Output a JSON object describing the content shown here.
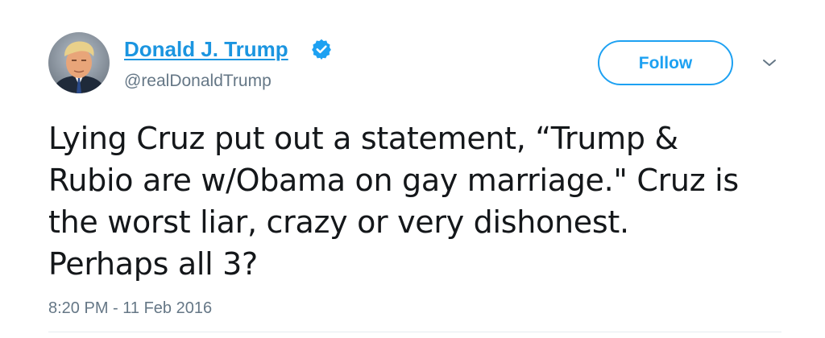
{
  "tweet": {
    "author": {
      "name": "Donald J. Trump",
      "handle": "@realDonaldTrump",
      "verified": true,
      "avatar_icon": "profile-photo"
    },
    "follow_label": "Follow",
    "text": "Lying Cruz put out a statement, “Trump &\nRubio are w/Obama on gay marriage.\" Cruz is\nthe worst liar, crazy or very dishonest.\nPerhaps all 3?",
    "timestamp": "8:20 PM - 11 Feb 2016"
  },
  "colors": {
    "link_blue": "#1b95e0",
    "button_blue": "#1da1f2",
    "secondary_text": "#657786",
    "primary_text": "#14171a"
  },
  "icons": {
    "verified": "verified-badge-icon",
    "more": "chevron-down-icon"
  }
}
